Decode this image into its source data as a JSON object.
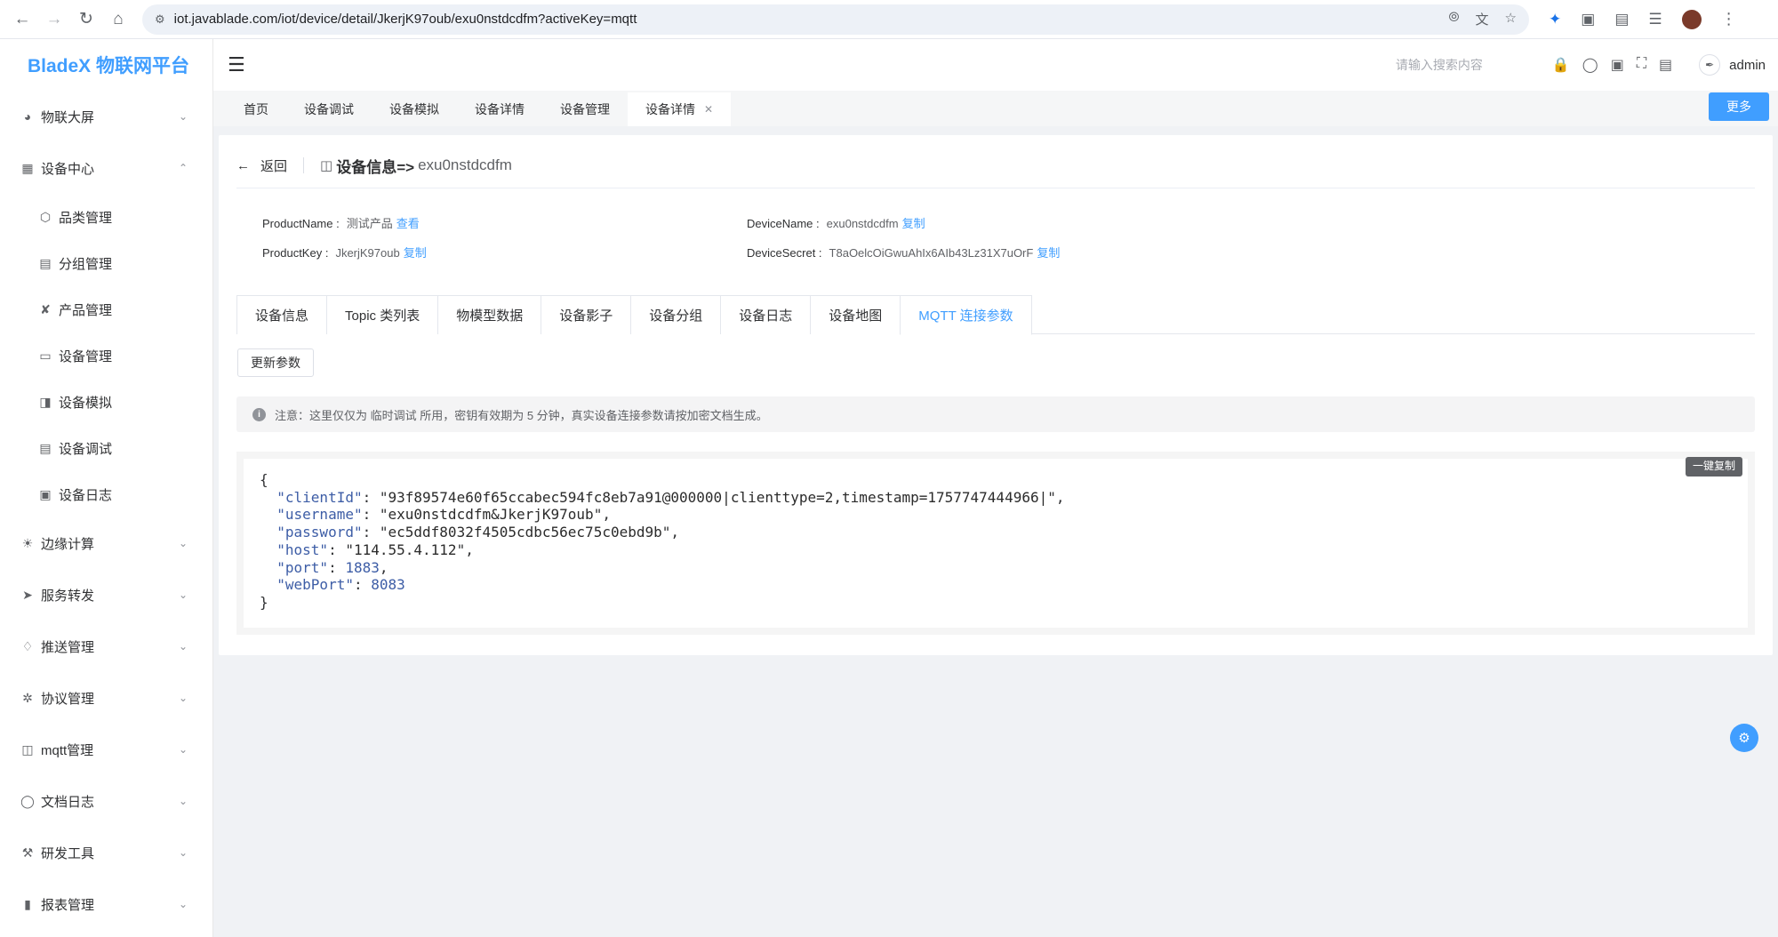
{
  "browser": {
    "url": "iot.javablade.com/iot/device/detail/JkerjK97oub/exu0nstdcdfm?activeKey=mqtt"
  },
  "sidebar": {
    "logo": "BladeX 物联网平台",
    "items": [
      {
        "label": "物联大屏",
        "icon": "dashboard-icon",
        "expanded": false
      },
      {
        "label": "设备中心",
        "icon": "table-icon",
        "expanded": true
      },
      {
        "label": "边缘计算",
        "icon": "edge-icon",
        "expanded": false
      },
      {
        "label": "服务转发",
        "icon": "send-icon",
        "expanded": false
      },
      {
        "label": "推送管理",
        "icon": "bell-icon",
        "expanded": false
      },
      {
        "label": "协议管理",
        "icon": "antenna-icon",
        "expanded": false
      },
      {
        "label": "mqtt管理",
        "icon": "mqtt-icon",
        "expanded": false
      },
      {
        "label": "文档日志",
        "icon": "shield-icon",
        "expanded": false
      },
      {
        "label": "研发工具",
        "icon": "tool-icon",
        "expanded": false
      },
      {
        "label": "报表管理",
        "icon": "chart-icon",
        "expanded": false
      }
    ],
    "subitems": [
      {
        "label": "品类管理",
        "icon": "cube-icon"
      },
      {
        "label": "分组管理",
        "icon": "group-icon"
      },
      {
        "label": "产品管理",
        "icon": "product-icon"
      },
      {
        "label": "设备管理",
        "icon": "monitor-icon"
      },
      {
        "label": "设备模拟",
        "icon": "sim-icon"
      },
      {
        "label": "设备调试",
        "icon": "debug-icon"
      },
      {
        "label": "设备日志",
        "icon": "log-icon"
      }
    ]
  },
  "header": {
    "search_placeholder": "请输入搜索内容",
    "username": "admin"
  },
  "tagsbar": {
    "tags": [
      "首页",
      "设备调试",
      "设备模拟",
      "设备详情",
      "设备管理",
      "设备详情"
    ],
    "active_index": 5,
    "more_label": "更多"
  },
  "detail": {
    "back_label": "返回",
    "title_label": "设备信息=>",
    "device_name_title": "exu0nstdcdfm",
    "product_name_key": "ProductName :",
    "product_name_val": "测试产品",
    "product_name_link": "查看",
    "product_key_key": "ProductKey :",
    "product_key_val": "JkerjK97oub",
    "device_name_key": "DeviceName :",
    "device_name_val": "exu0nstdcdfm",
    "device_secret_key": "DeviceSecret :",
    "device_secret_val": "T8aOelcOiGwuAhIx6AIb43Lz31X7uOrF",
    "copy_label": "复制"
  },
  "tabs": [
    {
      "label": "设备信息"
    },
    {
      "label": "Topic 类列表"
    },
    {
      "label": "物模型数据"
    },
    {
      "label": "设备影子"
    },
    {
      "label": "设备分组"
    },
    {
      "label": "设备日志"
    },
    {
      "label": "设备地图"
    },
    {
      "label": "MQTT 连接参数"
    }
  ],
  "active_tab": 7,
  "update_button": "更新参数",
  "notice": "注意：这里仅仅为 临时调试 所用，密钥有效期为 5 分钟，真实设备连接参数请按加密文档生成。",
  "code": {
    "copy_all": "一键复制",
    "clientId": "93f89574e60f65ccabec594fc8eb7a91@000000|clienttype=2,timestamp=1757747444966|",
    "username": "exu0nstdcdfm&JkerjK97oub",
    "password": "ec5ddf8032f4505cdbc56ec75c0ebd9b",
    "host": "114.55.4.112",
    "port": "1883",
    "webPort": "8083"
  },
  "colors": {
    "accent": "#409eff",
    "json_key": "#3d5da6"
  }
}
